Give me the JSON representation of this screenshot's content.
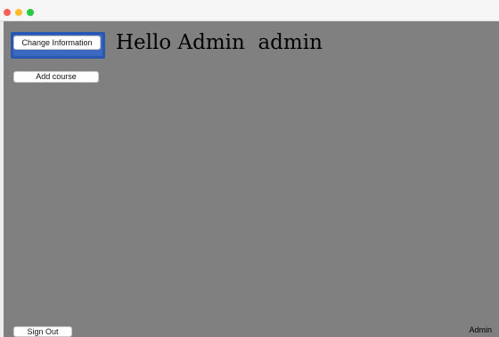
{
  "window": {
    "controls": {
      "close_icon": "close-icon",
      "minimize_icon": "minimize-icon",
      "zoom_icon": "zoom-icon"
    },
    "colors": {
      "close": "#fe5f57",
      "minimize": "#febc2e",
      "zoom": "#28c840",
      "content_background": "#808080",
      "focus_ring": "#2a58b0"
    }
  },
  "main": {
    "change_info_label": "Change Information",
    "add_course_label": "Add course",
    "greeting": "Hello Admin  admin",
    "sign_out_label": "Sign Out",
    "role_label": "Admin"
  }
}
